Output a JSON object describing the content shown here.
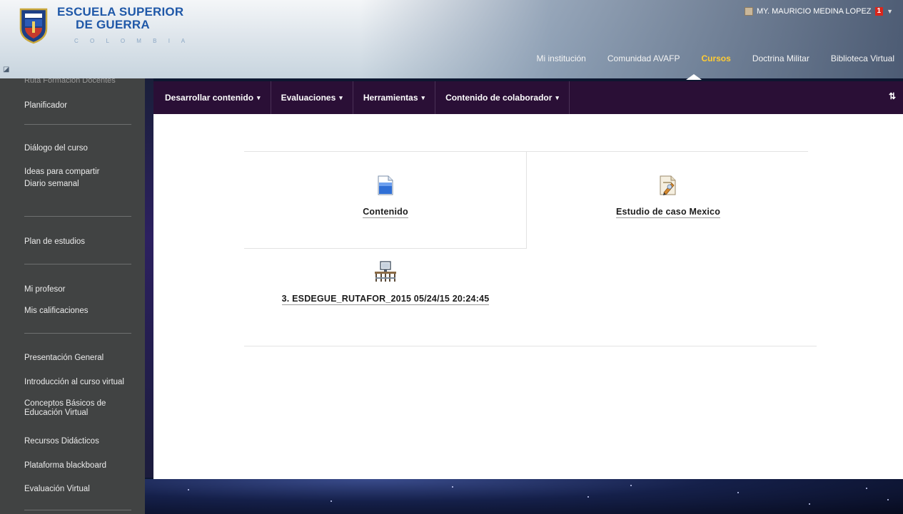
{
  "header": {
    "logo_line1": "ESCUELA SUPERIOR",
    "logo_line2": "DE GUERRA",
    "logo_sub": "C O L O M B I A",
    "user_name": "MY. MAURICIO MEDINA LOPEZ",
    "notification_count": "1",
    "nav": [
      {
        "label": "Mi institución",
        "active": false
      },
      {
        "label": "Comunidad AVAFP",
        "active": false
      },
      {
        "label": "Cursos",
        "active": true
      },
      {
        "label": "Doctrina Militar",
        "active": false
      },
      {
        "label": "Biblioteca Virtual",
        "active": false
      }
    ]
  },
  "sidebar": {
    "cut_item": "Ruta Formación Docentes",
    "items": [
      {
        "label": "Planificador"
      },
      {
        "label": "Diálogo del curso"
      },
      {
        "label": "Ideas para compartir"
      },
      {
        "label": "Diario semanal"
      },
      {
        "label": "Plan de estudios"
      },
      {
        "label": "Mi profesor"
      },
      {
        "label": "Mis calificaciones"
      },
      {
        "label": "Presentación General"
      },
      {
        "label": "Introducción al curso virtual"
      },
      {
        "label": "Conceptos Básicos de Educación Virtual"
      },
      {
        "label": "Recursos Didácticos"
      },
      {
        "label": "Plataforma blackboard"
      },
      {
        "label": "Evaluación Virtual"
      }
    ]
  },
  "toolbar": {
    "items": [
      {
        "label": "Desarrollar contenido"
      },
      {
        "label": "Evaluaciones"
      },
      {
        "label": "Herramientas"
      },
      {
        "label": "Contenido de colaborador"
      }
    ],
    "sort_icon": "sort-arrows-icon"
  },
  "content": {
    "tiles": [
      {
        "label": "Contenido",
        "icon": "document-icon"
      },
      {
        "label": "Estudio de caso Mexico",
        "icon": "case-study-icon"
      },
      {
        "label": "3. ESDEGUE_RUTAFOR_2015 05/24/15 20:24:45",
        "icon": "classroom-icon"
      }
    ]
  },
  "colors": {
    "sidebar_bg": "#414343",
    "toolbar_bg": "#2a0f36",
    "active_nav": "#ffcc33",
    "logo_blue": "#1f58a8"
  }
}
